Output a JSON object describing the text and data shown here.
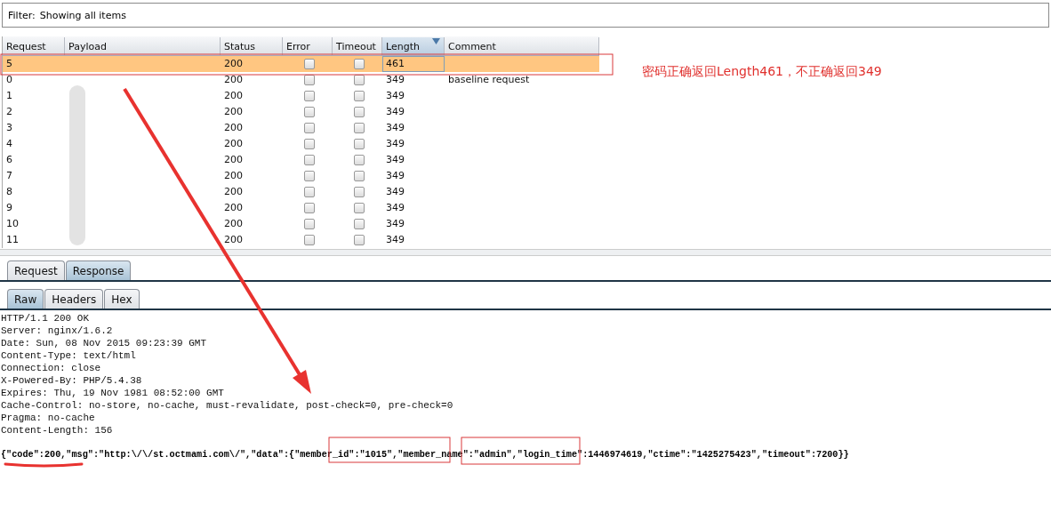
{
  "filter": {
    "label": "Filter:",
    "text": "Showing all items"
  },
  "table": {
    "columns": [
      {
        "label": "Request",
        "sorted": false
      },
      {
        "label": "Payload",
        "sorted": false
      },
      {
        "label": "Status",
        "sorted": false
      },
      {
        "label": "Error",
        "sorted": false
      },
      {
        "label": "Timeout",
        "sorted": false
      },
      {
        "label": "Length",
        "sorted": true
      },
      {
        "label": "Comment",
        "sorted": false
      }
    ],
    "rows": [
      {
        "request": "5",
        "status": "200",
        "error": false,
        "timeout": false,
        "length": "461",
        "comment": "",
        "selected": true
      },
      {
        "request": "0",
        "status": "200",
        "error": false,
        "timeout": false,
        "length": "349",
        "comment": "baseline request",
        "selected": false
      },
      {
        "request": "1",
        "status": "200",
        "error": false,
        "timeout": false,
        "length": "349",
        "comment": "",
        "selected": false
      },
      {
        "request": "2",
        "status": "200",
        "error": false,
        "timeout": false,
        "length": "349",
        "comment": "",
        "selected": false
      },
      {
        "request": "3",
        "status": "200",
        "error": false,
        "timeout": false,
        "length": "349",
        "comment": "",
        "selected": false
      },
      {
        "request": "4",
        "status": "200",
        "error": false,
        "timeout": false,
        "length": "349",
        "comment": "",
        "selected": false
      },
      {
        "request": "6",
        "status": "200",
        "error": false,
        "timeout": false,
        "length": "349",
        "comment": "",
        "selected": false
      },
      {
        "request": "7",
        "status": "200",
        "error": false,
        "timeout": false,
        "length": "349",
        "comment": "",
        "selected": false
      },
      {
        "request": "8",
        "status": "200",
        "error": false,
        "timeout": false,
        "length": "349",
        "comment": "",
        "selected": false
      },
      {
        "request": "9",
        "status": "200",
        "error": false,
        "timeout": false,
        "length": "349",
        "comment": "",
        "selected": false
      },
      {
        "request": "10",
        "status": "200",
        "error": false,
        "timeout": false,
        "length": "349",
        "comment": "",
        "selected": false
      },
      {
        "request": "11",
        "status": "200",
        "error": false,
        "timeout": false,
        "length": "349",
        "comment": "",
        "selected": false
      }
    ]
  },
  "tabs": [
    {
      "label": "Request",
      "selected": false
    },
    {
      "label": "Response",
      "selected": true
    }
  ],
  "subtabs": [
    {
      "label": "Raw",
      "selected": true
    },
    {
      "label": "Headers",
      "selected": false
    },
    {
      "label": "Hex",
      "selected": false
    }
  ],
  "response": {
    "headers": [
      "HTTP/1.1 200 OK",
      "Server: nginx/1.6.2",
      "Date: Sun, 08 Nov 2015 09:23:39 GMT",
      "Content-Type: text/html",
      "Connection: close",
      "X-Powered-By: PHP/5.4.38",
      "Expires: Thu, 19 Nov 1981 08:52:00 GMT",
      "Cache-Control: no-store, no-cache, must-revalidate, post-check=0, pre-check=0",
      "Pragma: no-cache",
      "Content-Length: 156"
    ],
    "body": "{\"code\":200,\"msg\":\"http:\\/\\/st.octmami.com\\/\",\"data\":{\"member_id\":\"1015\",\"member_name\":\"admin\",\"login_time\":1446974619,\"ctime\":\"1425275423\",\"timeout\":7200}}"
  },
  "annotation": "密码正确返回Length461，不正确返回349"
}
